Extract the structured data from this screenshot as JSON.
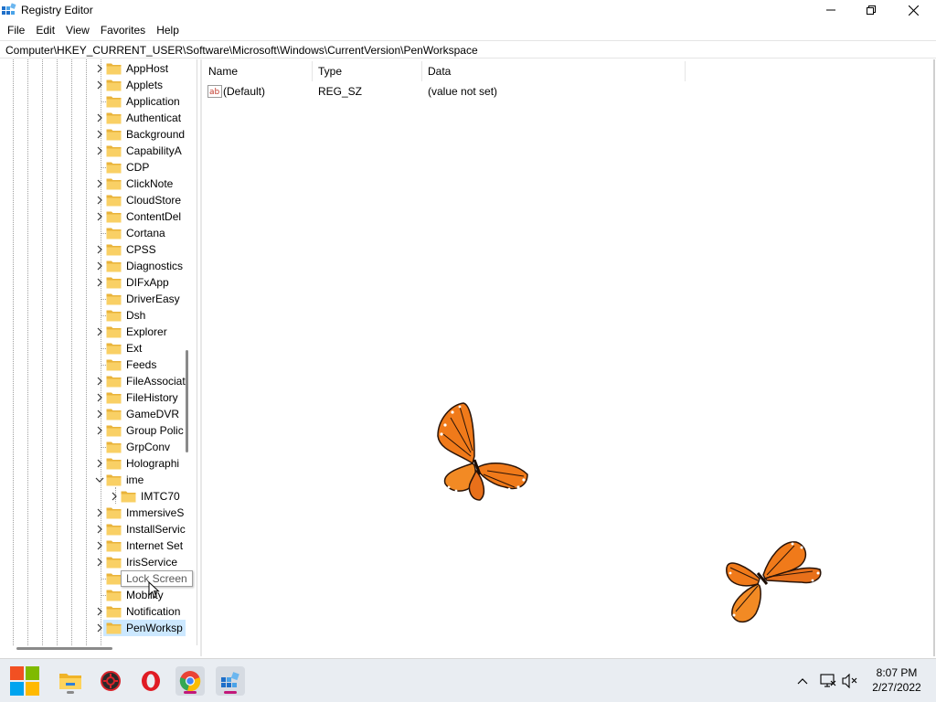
{
  "window": {
    "title": "Registry Editor",
    "controls": {
      "minimize": "minimize-icon",
      "maximize": "restore-icon",
      "close": "close-icon"
    }
  },
  "menu": [
    "File",
    "Edit",
    "View",
    "Favorites",
    "Help"
  ],
  "address": "Computer\\HKEY_CURRENT_USER\\Software\\Microsoft\\Windows\\CurrentVersion\\PenWorkspace",
  "tree": {
    "items": [
      {
        "label": "AppHost",
        "expandable": true,
        "level": 0
      },
      {
        "label": "Applets",
        "expandable": true,
        "level": 0
      },
      {
        "label": "Application",
        "expandable": false,
        "level": 0
      },
      {
        "label": "Authenticat",
        "expandable": true,
        "level": 0
      },
      {
        "label": "Background",
        "expandable": true,
        "level": 0
      },
      {
        "label": "CapabilityA",
        "expandable": true,
        "level": 0
      },
      {
        "label": "CDP",
        "expandable": false,
        "level": 0
      },
      {
        "label": "ClickNote",
        "expandable": true,
        "level": 0
      },
      {
        "label": "CloudStore",
        "expandable": true,
        "level": 0
      },
      {
        "label": "ContentDel",
        "expandable": true,
        "level": 0
      },
      {
        "label": "Cortana",
        "expandable": false,
        "level": 0
      },
      {
        "label": "CPSS",
        "expandable": true,
        "level": 0
      },
      {
        "label": "Diagnostics",
        "expandable": true,
        "level": 0
      },
      {
        "label": "DIFxApp",
        "expandable": true,
        "level": 0
      },
      {
        "label": "DriverEasy",
        "expandable": false,
        "level": 0
      },
      {
        "label": "Dsh",
        "expandable": false,
        "level": 0
      },
      {
        "label": "Explorer",
        "expandable": true,
        "level": 0
      },
      {
        "label": "Ext",
        "expandable": false,
        "level": 0
      },
      {
        "label": "Feeds",
        "expandable": false,
        "level": 0
      },
      {
        "label": "FileAssociat",
        "expandable": true,
        "level": 0
      },
      {
        "label": "FileHistory",
        "expandable": true,
        "level": 0
      },
      {
        "label": "GameDVR",
        "expandable": true,
        "level": 0
      },
      {
        "label": "Group Polic",
        "expandable": true,
        "level": 0
      },
      {
        "label": "GrpConv",
        "expandable": false,
        "level": 0
      },
      {
        "label": "Holographi",
        "expandable": true,
        "level": 0
      },
      {
        "label": "ime",
        "expandable": true,
        "expanded": true,
        "level": 0
      },
      {
        "label": "IMTC70",
        "expandable": true,
        "level": 1
      },
      {
        "label": "ImmersiveS",
        "expandable": true,
        "level": 0
      },
      {
        "label": "InstallServic",
        "expandable": true,
        "level": 0
      },
      {
        "label": "Internet Set",
        "expandable": true,
        "level": 0
      },
      {
        "label": "IrisService",
        "expandable": true,
        "level": 0
      },
      {
        "label": "Lock Screen",
        "expandable": false,
        "level": 0
      },
      {
        "label": "Mobility",
        "expandable": false,
        "level": 0
      },
      {
        "label": "Notification",
        "expandable": true,
        "level": 0
      },
      {
        "label": "PenWorksp",
        "expandable": true,
        "level": 0,
        "selected": true
      }
    ],
    "tooltip": "Lock Screen"
  },
  "values": {
    "columns": [
      "Name",
      "Type",
      "Data"
    ],
    "rows": [
      {
        "icon": "string-value-icon",
        "name": "(Default)",
        "type": "REG_SZ",
        "data": "(value not set)"
      }
    ]
  },
  "taskbar": {
    "apps": [
      {
        "name": "start-button",
        "icon": "windows-logo-icon"
      },
      {
        "name": "file-explorer",
        "icon": "folder-icon"
      },
      {
        "name": "driver-booster",
        "icon": "gear-shield-icon"
      },
      {
        "name": "opera-browser",
        "icon": "opera-icon"
      },
      {
        "name": "chrome-browser",
        "icon": "chrome-icon"
      },
      {
        "name": "registry-editor",
        "icon": "regedit-icon"
      }
    ],
    "tray": [
      "chevron-up-icon",
      "network-icon",
      "volume-muted-icon"
    ],
    "time": "8:07 PM",
    "date": "2/27/2022"
  },
  "colors": {
    "selection": "#cce8ff",
    "folder": "#f9d065",
    "taskbar": "#e9edf2",
    "butterfly": "#f07a1a"
  }
}
